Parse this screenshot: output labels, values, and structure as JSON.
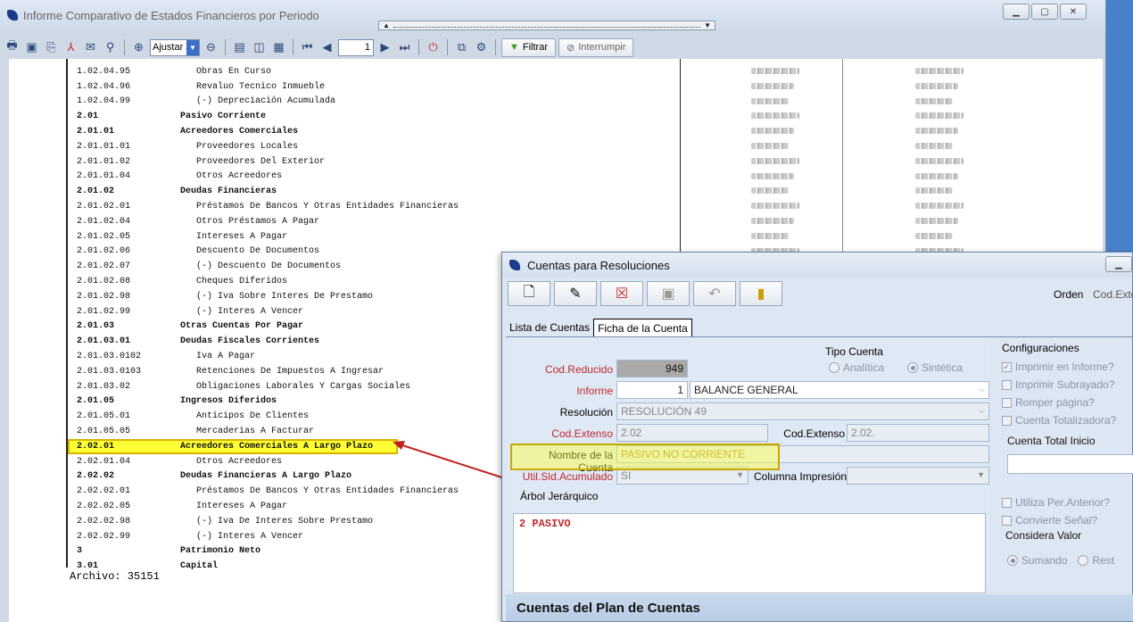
{
  "main_window": {
    "title": "Informe Comparativo de Estados Financieros por Periodo",
    "zoom_select": "Ajustar a",
    "page_number": "1",
    "filter_button": "Filtrar",
    "stop_button": "Interrumpir"
  },
  "report": {
    "rows": [
      {
        "code": "1.02.04.95",
        "desc": "Obras En Curso",
        "level": 2
      },
      {
        "code": "1.02.04.96",
        "desc": "Revaluo Tecnico Inmueble",
        "level": 2
      },
      {
        "code": "1.02.04.99",
        "desc": "(-) Depreciación Acumulada",
        "level": 2
      },
      {
        "code": "2.01",
        "desc": "Pasivo Corriente",
        "level": 1,
        "bold": true
      },
      {
        "code": "2.01.01",
        "desc": "Acreedores Comerciales",
        "level": 1,
        "bold": true
      },
      {
        "code": "2.01.01.01",
        "desc": "Proveedores Locales",
        "level": 2
      },
      {
        "code": "2.01.01.02",
        "desc": "Proveedores Del Exterior",
        "level": 2
      },
      {
        "code": "2.01.01.04",
        "desc": "Otros Acreedores",
        "level": 2
      },
      {
        "code": "2.01.02",
        "desc": "Deudas Financieras",
        "level": 1,
        "bold": true
      },
      {
        "code": "2.01.02.01",
        "desc": "Préstamos De Bancos Y Otras Entidades Financieras",
        "level": 2
      },
      {
        "code": "2.01.02.04",
        "desc": "Otros Préstamos A Pagar",
        "level": 2
      },
      {
        "code": "2.01.02.05",
        "desc": "Intereses A Pagar",
        "level": 2
      },
      {
        "code": "2.01.02.06",
        "desc": "Descuento De Documentos",
        "level": 2
      },
      {
        "code": "2.01.02.07",
        "desc": "(-) Descuento De Documentos",
        "level": 2
      },
      {
        "code": "2.01.02.08",
        "desc": "Cheques Diferidos",
        "level": 2
      },
      {
        "code": "2.01.02.98",
        "desc": "(-) Iva Sobre Interes De Prestamo",
        "level": 2
      },
      {
        "code": "2.01.02.99",
        "desc": "(-) Interes A Vencer",
        "level": 2
      },
      {
        "code": "2.01.03",
        "desc": "Otras Cuentas Por Pagar",
        "level": 1,
        "bold": true
      },
      {
        "code": "2.01.03.01",
        "desc": "Deudas Fiscales Corrientes",
        "level": 1,
        "bold": true
      },
      {
        "code": "2.01.03.0102",
        "desc": "Iva A Pagar",
        "level": 2
      },
      {
        "code": "2.01.03.0103",
        "desc": "Retenciones De Impuestos A Ingresar",
        "level": 2
      },
      {
        "code": "2.01.03.02",
        "desc": "Obligaciones Laborales Y Cargas Sociales",
        "level": 2
      },
      {
        "code": "2.01.05",
        "desc": "Ingresos Diferidos",
        "level": 1,
        "bold": true
      },
      {
        "code": "2.01.05.01",
        "desc": "Anticipos De Clientes",
        "level": 2
      },
      {
        "code": "2.01.05.05",
        "desc": "Mercaderias A Facturar",
        "level": 2
      },
      {
        "code": "2.02.01",
        "desc": "Acreedores Comerciales A Largo Plazo",
        "level": 1,
        "bold": true,
        "highlight": true
      },
      {
        "code": "2.02.01.04",
        "desc": "Otros Acreedores",
        "level": 2
      },
      {
        "code": "2.02.02",
        "desc": "Deudas Financieras A Largo Plazo",
        "level": 1,
        "bold": true
      },
      {
        "code": "2.02.02.01",
        "desc": "Préstamos De Bancos Y Otras Entidades Financieras",
        "level": 2
      },
      {
        "code": "2.02.02.05",
        "desc": "Intereses A Pagar",
        "level": 2
      },
      {
        "code": "2.02.02.98",
        "desc": "(-) Iva De Interes Sobre Prestamo",
        "level": 2
      },
      {
        "code": "2.02.02.99",
        "desc": "(-) Interes A Vencer",
        "level": 2
      },
      {
        "code": "3",
        "desc": "Patrimonio Neto",
        "level": 1,
        "bold": true
      },
      {
        "code": "3.01",
        "desc": "Capital",
        "level": 1,
        "bold": true
      }
    ],
    "archivo": "Archivo: 35151"
  },
  "dialog": {
    "title": "Cuentas para Resoluciones",
    "orden_label": "Orden",
    "orden_value": "Cod.Exte",
    "tabs": [
      "Lista de Cuentas",
      "Ficha de la Cuenta"
    ],
    "tipo_cuenta_label": "Tipo Cuenta",
    "tipo_analitica": "Analítica",
    "tipo_sintetica": "Sintética",
    "cod_reducido_label": "Cod.Reducido",
    "cod_reducido_value": "949",
    "informe_label": "Informe",
    "informe_num": "1",
    "informe_value": "BALANCE GENERAL",
    "resolucion_label": "Resolución",
    "resolucion_value": "RESOLUCIÓN 49",
    "cod_extenso_label": "Cod.Extenso",
    "cod_extenso_value": "2.02",
    "cod_extenso2_label": "Cod.Extenso",
    "cod_extenso2_value": "2.02.",
    "nombre_label": "Nombre de la Cuenta",
    "nombre_value": "PASIVO  NO CORRIENTE",
    "util_label": "Util.Sld.Acumulado",
    "util_value": "SI",
    "columna_label": "Columna Impresión",
    "arbol_label": "Árbol Jerárquico",
    "arbol_value": "2  PASIVO",
    "config_title": "Configuraciones",
    "config_items": [
      "Imprimir en Informe?",
      "Imprimir Subrayado?",
      "Romper página?",
      "Cuenta Totalizadora?"
    ],
    "cuenta_total_label": "Cuenta Total Inicio",
    "config_items2": [
      "Utiliza Per.Anterior?",
      "Convierte Señal?"
    ],
    "considera_label": "Considera Valor",
    "sumando": "Sumando",
    "restando": "Rest",
    "plan_bar": "Cuentas del Plan de Cuentas"
  }
}
